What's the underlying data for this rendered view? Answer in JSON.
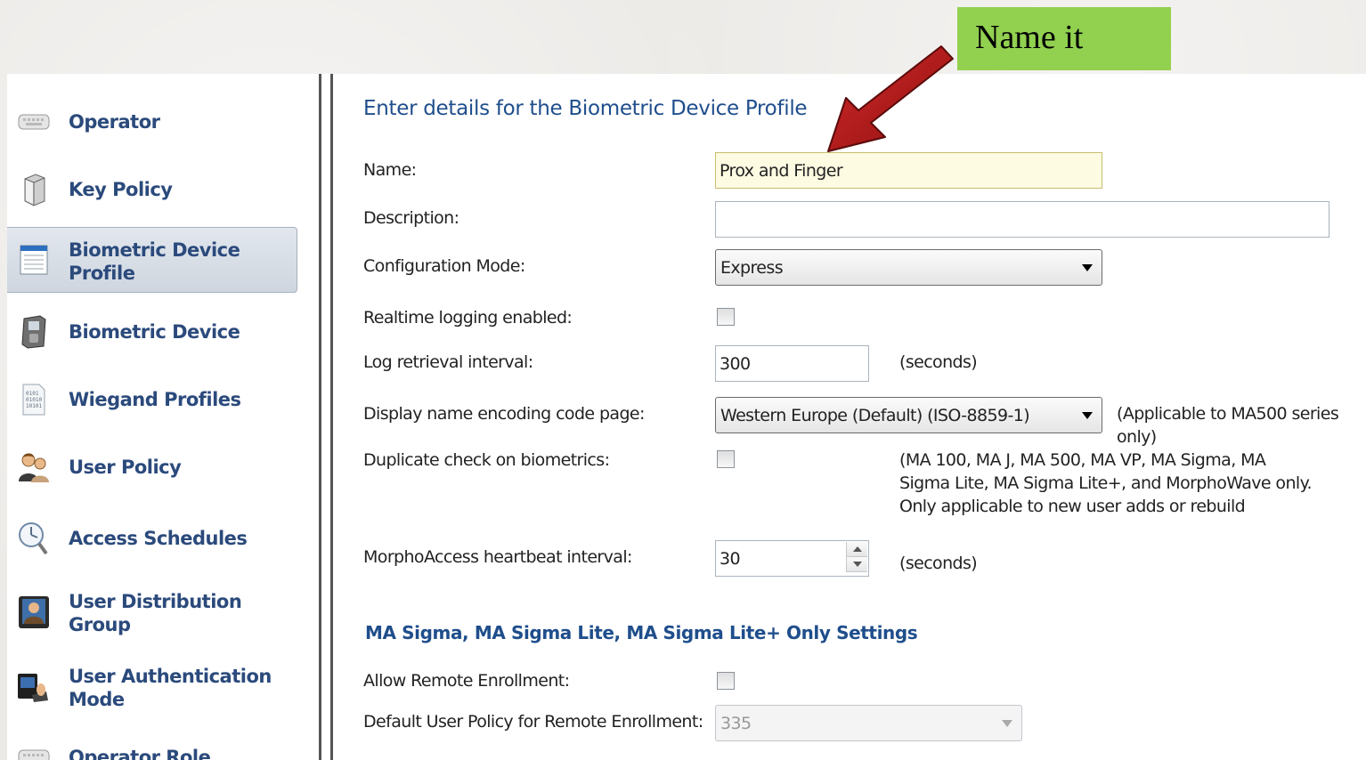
{
  "callout": {
    "text": "Name it",
    "color": "#92d050"
  },
  "sidebar": {
    "selected_index": 2,
    "items": [
      {
        "label_lines": [
          "Operator"
        ],
        "icon": "keyboard-icon"
      },
      {
        "label_lines": [
          "Key Policy"
        ],
        "icon": "server-tower-icon"
      },
      {
        "label_lines": [
          "Biometric Device",
          "Profile"
        ],
        "icon": "profile-window-icon"
      },
      {
        "label_lines": [
          "Biometric Device"
        ],
        "icon": "biometric-terminal-icon"
      },
      {
        "label_lines": [
          "Wiegand Profiles"
        ],
        "icon": "binary-document-icon"
      },
      {
        "label_lines": [
          "User Policy"
        ],
        "icon": "users-icon"
      },
      {
        "label_lines": [
          "Access Schedules"
        ],
        "icon": "clock-search-icon"
      },
      {
        "label_lines": [
          "User Distribution",
          "Group"
        ],
        "icon": "user-portrait-icon"
      },
      {
        "label_lines": [
          "User Authentication",
          "Mode"
        ],
        "icon": "fingerprint-reader-icon"
      },
      {
        "label_lines": [
          "Operator Role"
        ],
        "icon": "keyboard-icon"
      }
    ]
  },
  "form": {
    "title": "Enter details for the Biometric Device Profile",
    "name": {
      "label": "Name:",
      "value": "Prox and Finger"
    },
    "description": {
      "label": "Description:",
      "value": ""
    },
    "configuration_mode": {
      "label": "Configuration Mode:",
      "selected": "Express"
    },
    "realtime_logging": {
      "label": "Realtime logging enabled:",
      "checked": false
    },
    "log_retrieval": {
      "label": "Log retrieval interval:",
      "value": "300",
      "unit": "(seconds)"
    },
    "display_encoding": {
      "label": "Display name encoding code page:",
      "selected": "Western Europe (Default) (ISO-8859-1)",
      "note": "(Applicable to MA500 series only)"
    },
    "duplicate_check": {
      "label": "Duplicate check on biometrics:",
      "checked": false,
      "note_lines": [
        "(MA 100, MA J, MA 500, MA VP, MA Sigma, MA",
        "Sigma Lite, MA Sigma Lite+, and MorphoWave only.",
        "Only applicable to new user adds or rebuild"
      ]
    },
    "heartbeat": {
      "label": "MorphoAccess heartbeat interval:",
      "value": "30",
      "unit": "(seconds)"
    },
    "sigma_section": {
      "title": "MA Sigma, MA Sigma Lite, MA Sigma Lite+ Only Settings",
      "remote_enrollment": {
        "label": "Allow Remote Enrollment:",
        "checked": false
      },
      "default_user_policy": {
        "label": "Default User Policy for Remote Enrollment:",
        "selected": "335"
      }
    }
  }
}
